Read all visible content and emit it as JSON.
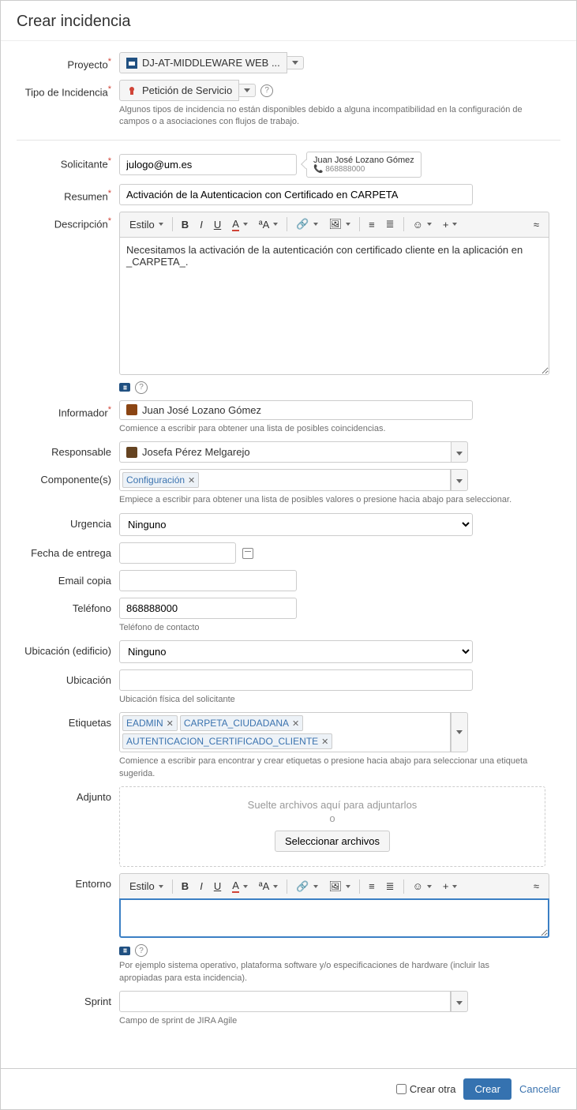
{
  "header": {
    "title": "Crear incidencia"
  },
  "project": {
    "label": "Proyecto",
    "value": "DJ-AT-MIDDLEWARE WEB ..."
  },
  "issueType": {
    "label": "Tipo de Incidencia",
    "value": "Petición de Servicio",
    "hint": "Algunos tipos de incidencia no están disponibles debido a alguna incompatibilidad en la configuración de campos o a asociaciones con flujos de trabajo."
  },
  "requester": {
    "label": "Solicitante",
    "value": "julogo@um.es",
    "tooltip_name": "Juan José Lozano Gómez",
    "tooltip_phone": "868888000"
  },
  "summary": {
    "label": "Resumen",
    "value": "Activación de la Autenticacion con Certificado en CARPETA"
  },
  "description": {
    "label": "Descripción",
    "value": "Necesitamos la activación de la autenticación con certificado cliente en la aplicación en _CARPETA_."
  },
  "toolbar": {
    "style": "Estilo",
    "sup_a": "ªA"
  },
  "reporter": {
    "label": "Informador",
    "value": "Juan José Lozano Gómez",
    "hint": "Comience a escribir para obtener una lista de posibles coincidencias."
  },
  "assignee": {
    "label": "Responsable",
    "value": "Josefa Pérez Melgarejo"
  },
  "components": {
    "label": "Componente(s)",
    "tags": [
      "Configuración"
    ],
    "hint": "Empiece a escribir para obtener una lista de posibles valores o presione hacia abajo para seleccionar."
  },
  "urgency": {
    "label": "Urgencia",
    "value": "Ninguno"
  },
  "dueDate": {
    "label": "Fecha de entrega",
    "value": ""
  },
  "emailCopy": {
    "label": "Email copia",
    "value": ""
  },
  "phone": {
    "label": "Teléfono",
    "value": "868888000",
    "hint": "Teléfono de contacto"
  },
  "building": {
    "label": "Ubicación (edificio)",
    "value": "Ninguno"
  },
  "location": {
    "label": "Ubicación",
    "value": "",
    "hint": "Ubicación física del solicitante"
  },
  "tags": {
    "label": "Etiquetas",
    "items": [
      "EADMIN",
      "CARPETA_CIUDADANA",
      "AUTENTICACION_CERTIFICADO_CLIENTE"
    ],
    "hint": "Comience a escribir para encontrar y crear etiquetas o presione hacia abajo para seleccionar una etiqueta sugerida."
  },
  "attachment": {
    "label": "Adjunto",
    "dropText": "Suelte archivos aquí para adjuntarlos",
    "or": "o",
    "button": "Seleccionar archivos"
  },
  "environment": {
    "label": "Entorno",
    "value": "",
    "hint": "Por ejemplo sistema operativo, plataforma software y/o especificaciones de hardware (incluir las apropiadas para esta incidencia)."
  },
  "sprint": {
    "label": "Sprint",
    "value": "",
    "hint": "Campo de sprint de JIRA Agile"
  },
  "footer": {
    "createAnother": "Crear otra",
    "create": "Crear",
    "cancel": "Cancelar"
  }
}
